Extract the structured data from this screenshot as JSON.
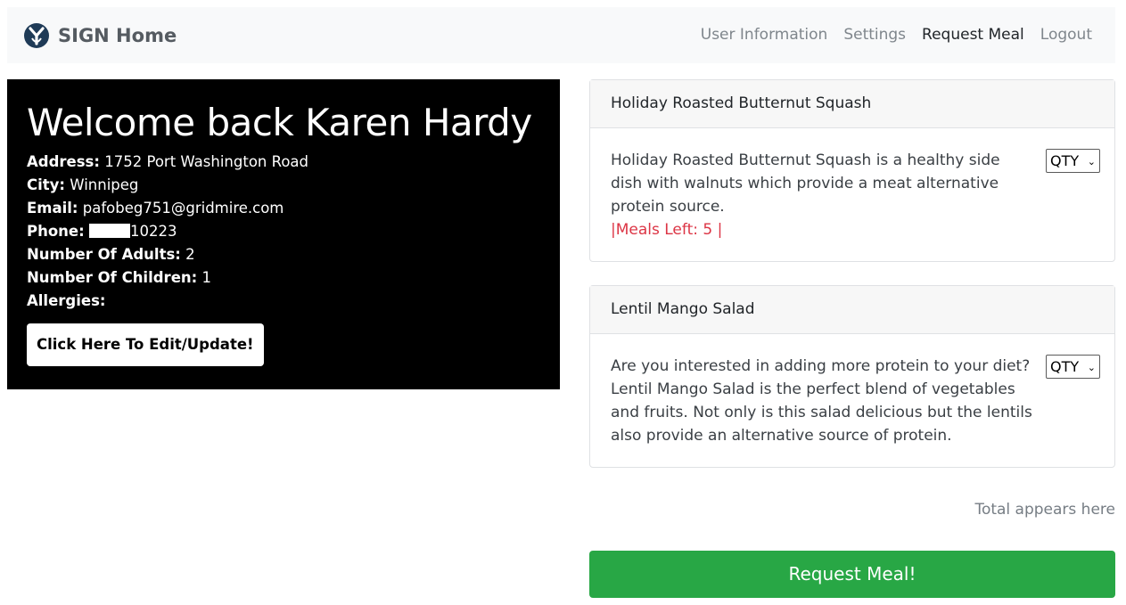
{
  "navbar": {
    "brand": "SIGN Home",
    "links": [
      "User Information",
      "Settings",
      "Request Meal",
      "Logout"
    ]
  },
  "welcome": {
    "heading": "Welcome back Karen Hardy",
    "address_label": "Address:",
    "address": "1752 Port Washington Road",
    "city_label": "City:",
    "city": "Winnipeg",
    "email_label": "Email:",
    "email": "pafobeg751@gridmire.com",
    "phone_label": "Phone:",
    "phone_visible": "10223",
    "adults_label": "Number Of Adults:",
    "adults": "2",
    "children_label": "Number Of Children:",
    "children": "1",
    "allergies_label": "Allergies:",
    "allergies": "",
    "edit_button": "Click Here To Edit/Update!"
  },
  "meals": [
    {
      "title": "Holiday Roasted Butternut Squash",
      "description": "Holiday Roasted Butternut Squash is a healthy side dish with walnuts which provide a meat alternative protein source.",
      "meals_left": "|Meals Left: 5 |",
      "qty_label": "QTY"
    },
    {
      "title": "Lentil Mango Salad",
      "description": "Are you interested in adding more protein to your diet? Lentil Mango Salad is the perfect blend of vegetables and fruits. Not only is this salad delicious but the lentils also provide an alternative source of protein.",
      "qty_label": "QTY"
    }
  ],
  "total_text": "Total appears here",
  "request_button": "Request Meal!",
  "colors": {
    "navbar_bg": "#f8f9fa",
    "welcome_bg": "#000000",
    "meals_left": "#dc3545",
    "request_button": "#28a745"
  },
  "icons": {
    "brand": "sign-logo-icon",
    "qty_dropdown": "chevron-down-icon"
  }
}
